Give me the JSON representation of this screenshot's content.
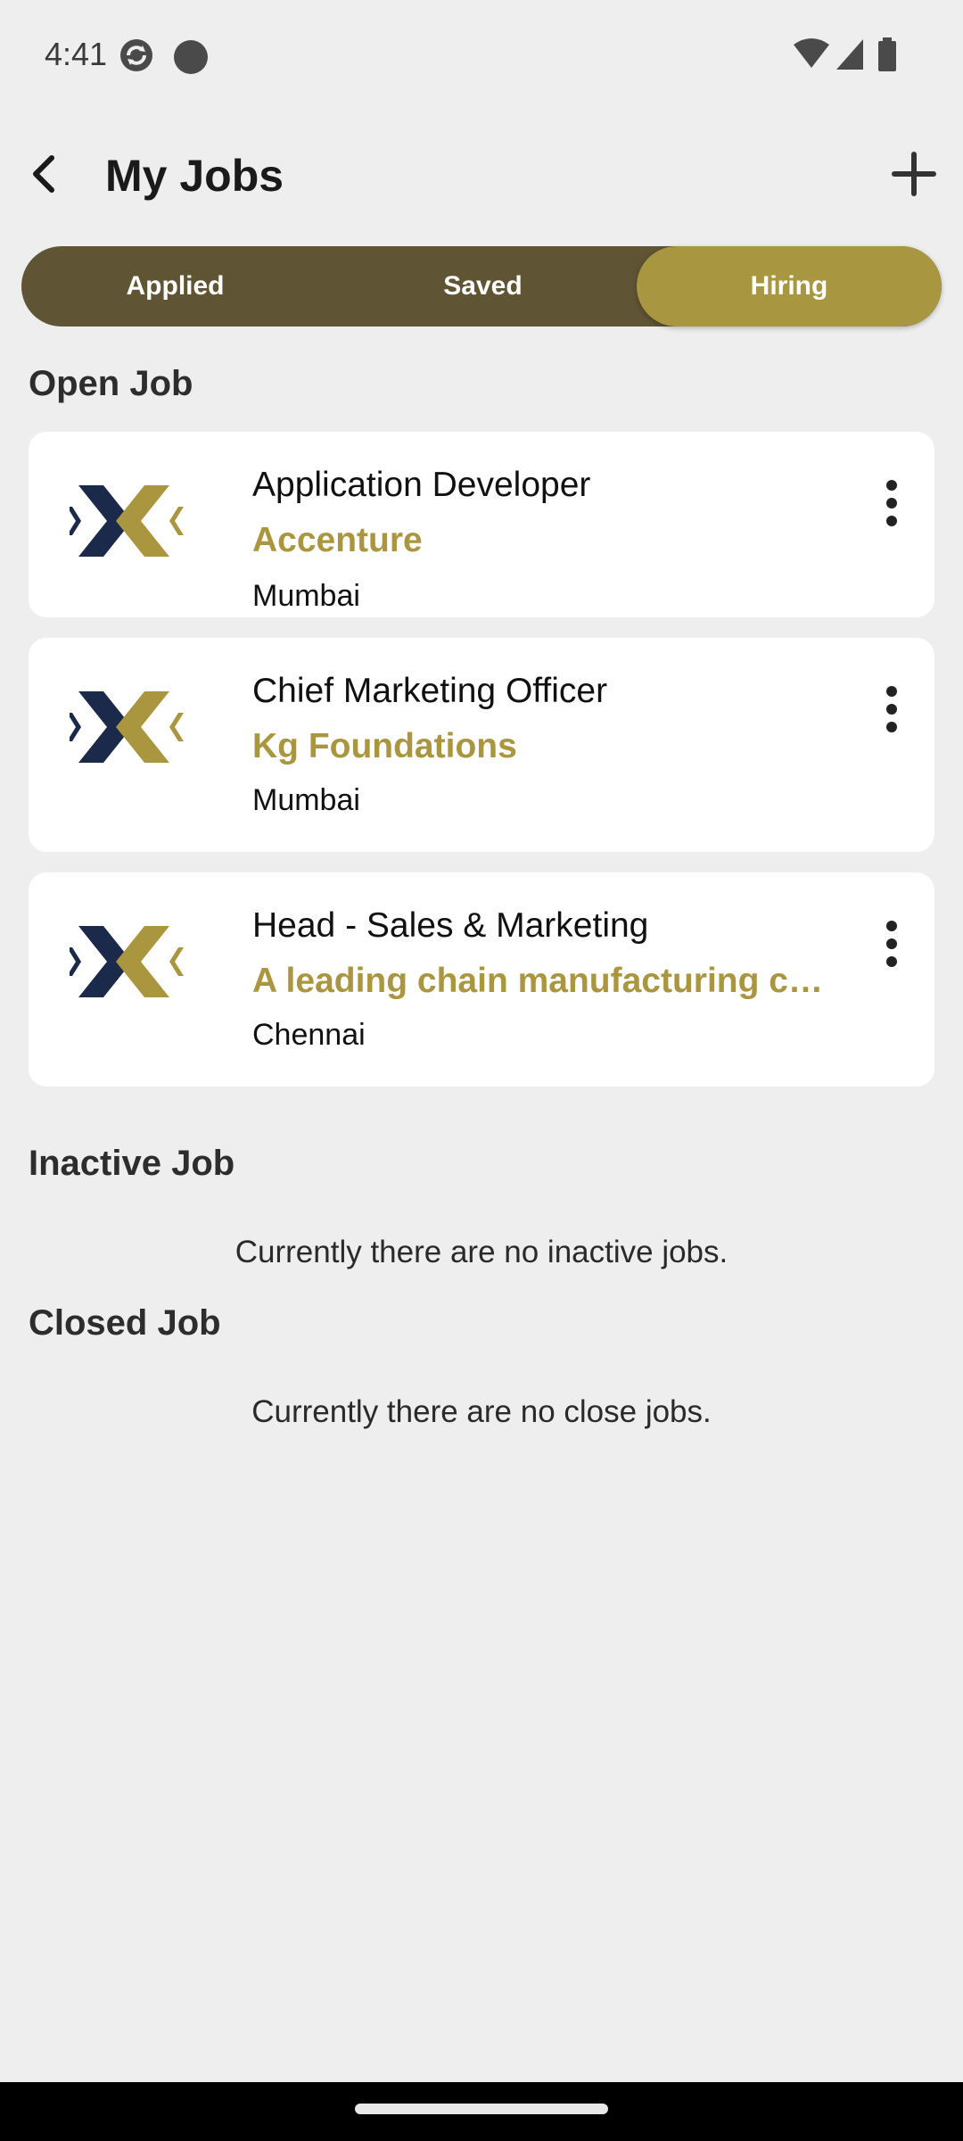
{
  "status_bar": {
    "time": "4:41",
    "icons": [
      "sync-icon",
      "notification-dot-icon",
      "wifi-icon",
      "signal-icon",
      "battery-icon"
    ]
  },
  "app_bar": {
    "title": "My Jobs",
    "back_icon": "back-arrow-icon",
    "add_icon": "plus-icon"
  },
  "tabs": {
    "items": [
      {
        "label": "Applied",
        "selected": false
      },
      {
        "label": "Saved",
        "selected": false
      },
      {
        "label": "Hiring",
        "selected": true
      }
    ],
    "colors": {
      "track": "#5f5434",
      "selected": "#a99640",
      "label": "#ffffff"
    }
  },
  "open_jobs": {
    "title": "Open Job",
    "jobs": [
      {
        "title": "Application Developer",
        "company": "Accenture",
        "location": "Mumbai"
      },
      {
        "title": "Chief Marketing Officer",
        "company": "Kg Foundations",
        "location": "Mumbai"
      },
      {
        "title": "Head - Sales & Marketing",
        "company": "A leading chain manufacturing c…",
        "location": "Chennai"
      }
    ]
  },
  "inactive_jobs": {
    "title": "Inactive Job",
    "empty_message": "Currently there are no inactive jobs."
  },
  "closed_jobs": {
    "title": "Closed Job",
    "empty_message": "Currently there are no close jobs."
  },
  "colors": {
    "accent_gold": "#ab9640",
    "logo_navy": "#1b2a4a",
    "background": "#eeeeee"
  }
}
